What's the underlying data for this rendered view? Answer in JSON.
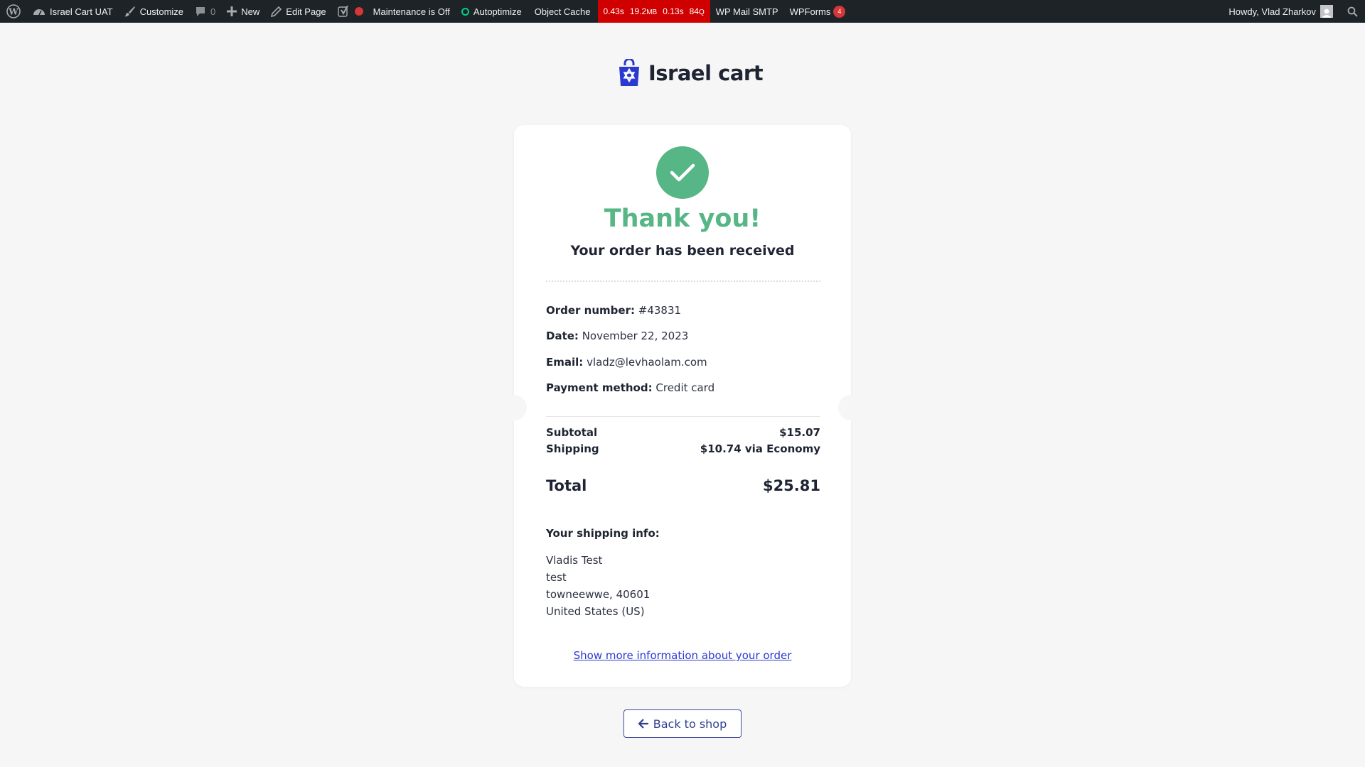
{
  "adminbar": {
    "site_name": "Israel Cart UAT",
    "customize": "Customize",
    "comments_count": "0",
    "new": "New",
    "edit_page": "Edit Page",
    "maintenance": "Maintenance is Off",
    "autoptimize": "Autoptimize",
    "object_cache": "Object Cache",
    "perf": {
      "time": "0.43s",
      "memory": "19.2",
      "memory_unit": "MB",
      "query_time": "0.13s",
      "queries": "84",
      "queries_unit": "Q"
    },
    "wp_mail_smtp": "WP Mail SMTP",
    "wpforms": "WPForms",
    "wpforms_badge": "4",
    "howdy": "Howdy, Vlad Zharkov",
    "colors": {
      "bar": "#1d2327",
      "perf": "#d10000",
      "badge": "#d63638",
      "maintenance_dot": "#d63638",
      "autoptimize_ring": "#00d084"
    }
  },
  "logo": {
    "text": "Israel cart",
    "icon": "shopping-bag-star-of-david-icon",
    "color": "#2a3ad1"
  },
  "confirmation": {
    "icon": "checkmark-icon",
    "title": "Thank you!",
    "subtitle": "Your order has been received",
    "accent": "#57b685"
  },
  "order": {
    "number_label": "Order number:",
    "number": "#43831",
    "date_label": "Date:",
    "date": "November 22, 2023",
    "email_label": "Email:",
    "email": "vladz@levhaolam.com",
    "payment_label": "Payment method:",
    "payment": "Credit card"
  },
  "totals": {
    "subtotal_label": "Subtotal",
    "subtotal": "$15.07",
    "shipping_label": "Shipping",
    "shipping": "$10.74 via Economy",
    "total_label": "Total",
    "total": "$25.81"
  },
  "shipping_info": {
    "title": "Your shipping info:",
    "lines": [
      "Vladis Test",
      "test",
      "towneewwe, 40601",
      "United States (US)"
    ]
  },
  "more_link": "Show more information about your order",
  "back_button": "Back to shop"
}
